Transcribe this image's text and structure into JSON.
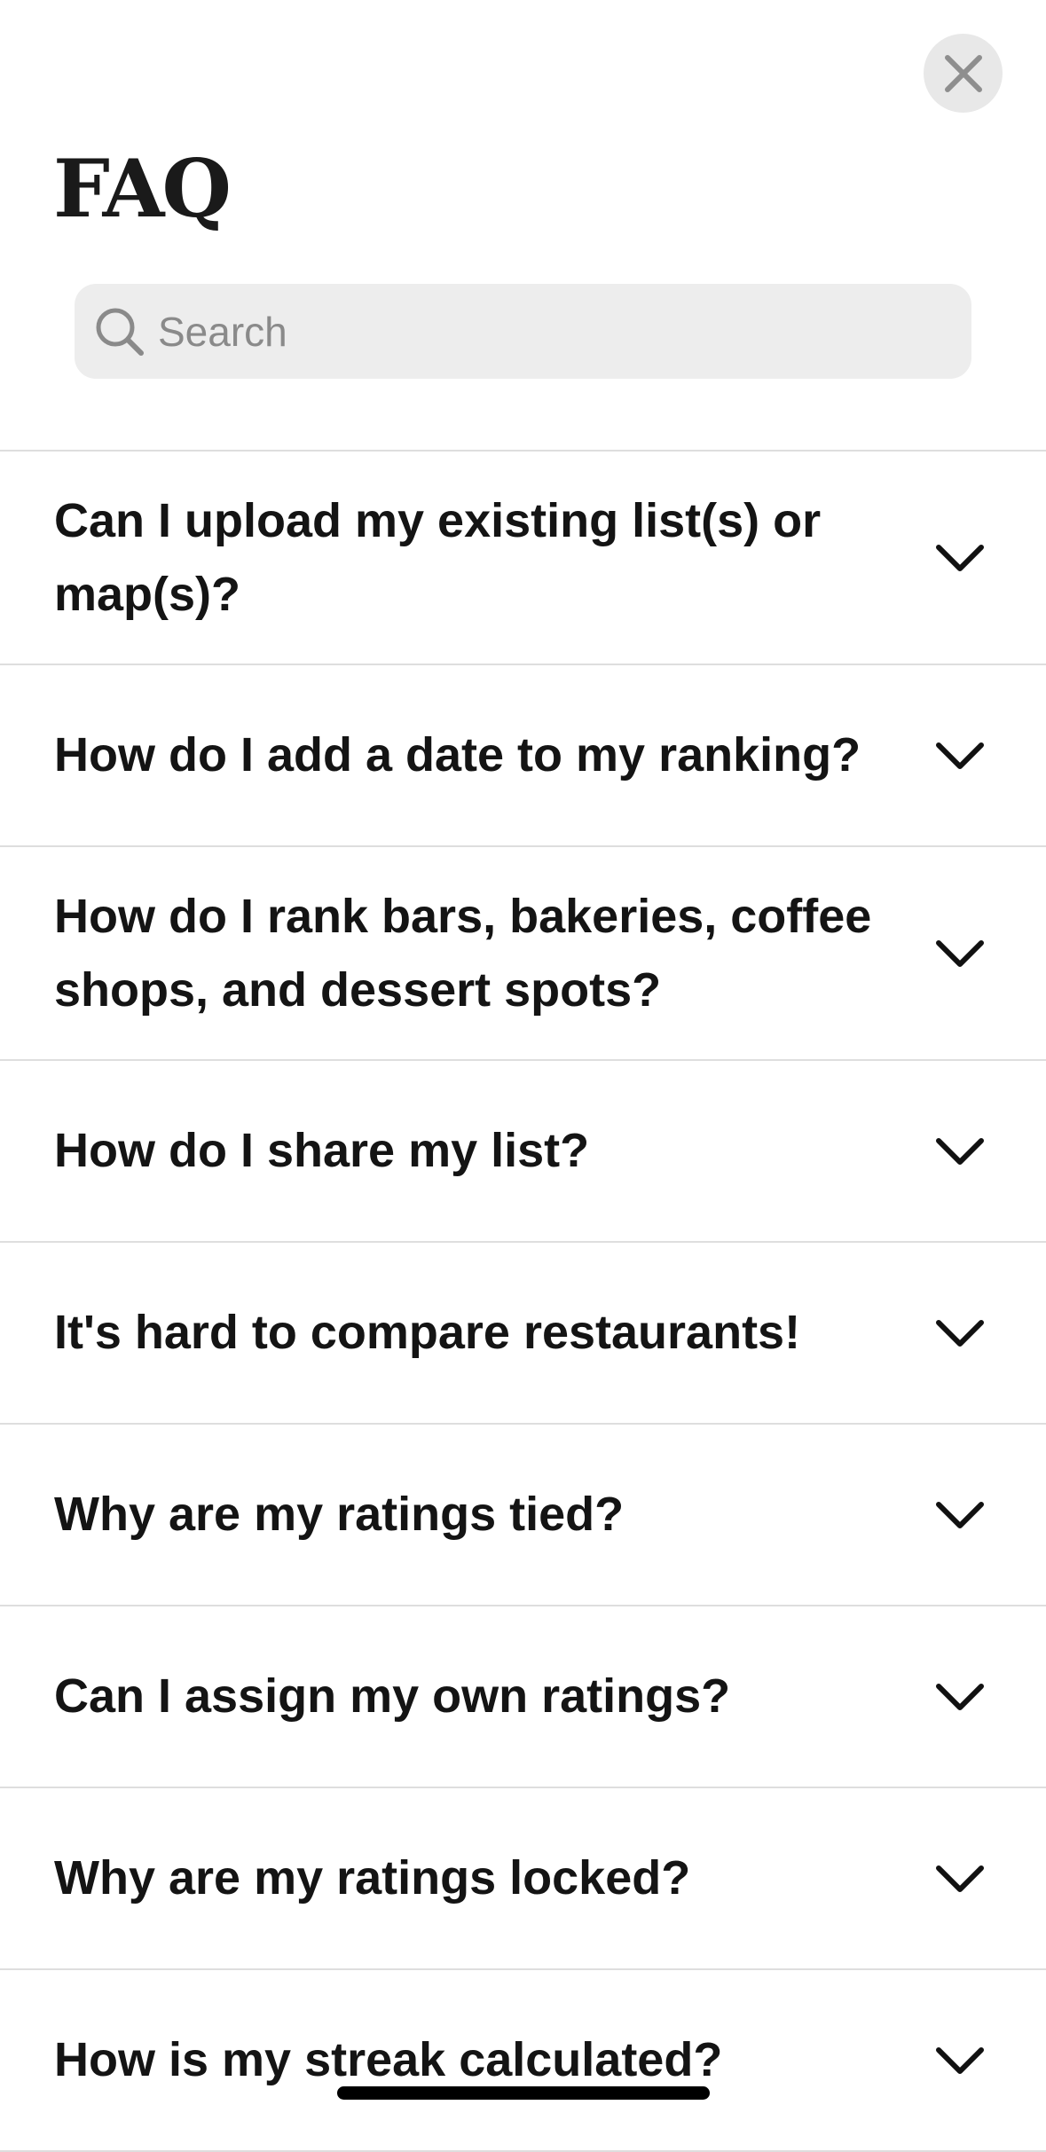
{
  "header": {
    "title": "FAQ",
    "close_icon": "close-icon"
  },
  "search": {
    "placeholder": "Search",
    "value": "",
    "icon": "search-icon"
  },
  "faq": {
    "items": [
      {
        "question": "Can I upload my existing list(s) or map(s)?",
        "expanded": false
      },
      {
        "question": "How do I add a date to my ranking?",
        "expanded": false
      },
      {
        "question": "How do I rank bars, bakeries, coffee shops, and dessert spots?",
        "expanded": false
      },
      {
        "question": "How do I share my list?",
        "expanded": false
      },
      {
        "question": "It's hard to compare restaurants!",
        "expanded": false
      },
      {
        "question": "Why are my ratings tied?",
        "expanded": false
      },
      {
        "question": "Can I assign my own ratings?",
        "expanded": false
      },
      {
        "question": "Why are my ratings locked?",
        "expanded": false
      },
      {
        "question": "How is my streak calculated?",
        "expanded": false
      }
    ],
    "chevron_icon": "chevron-down-icon"
  },
  "colors": {
    "background": "#ffffff",
    "search_background": "#ededed",
    "close_background": "#e8e8e8",
    "divider": "#dedede",
    "text": "#141414",
    "placeholder": "#8a8a8a"
  }
}
